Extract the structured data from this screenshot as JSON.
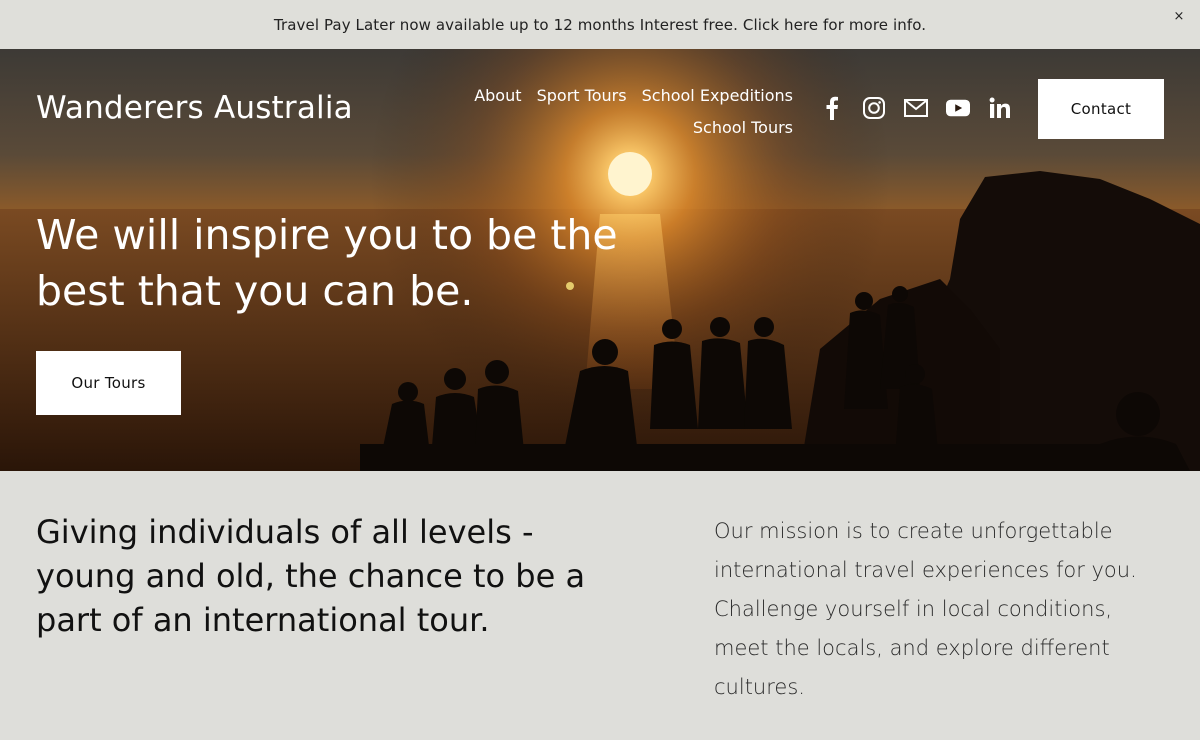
{
  "announcement": {
    "text": "Travel Pay Later now available up to 12 months Interest free. Click here for more info.",
    "close_symbol": "×"
  },
  "header": {
    "site_title": "Wanderers Australia",
    "nav": [
      {
        "label": "About"
      },
      {
        "label": "Sport Tours"
      },
      {
        "label": "School Expeditions"
      },
      {
        "label": "School Tours"
      }
    ],
    "social_icons": [
      "facebook-icon",
      "instagram-icon",
      "email-icon",
      "youtube-icon",
      "linkedin-icon"
    ],
    "contact_label": "Contact"
  },
  "hero": {
    "headline": "We will inspire you to be the best that you can be.",
    "cta_label": "Our Tours"
  },
  "intro": {
    "heading": "Giving individuals of all levels - young and old, the chance to be a part of an international tour.",
    "body": "Our mission is to create unforgettable international travel experiences for you. Challenge yourself in local conditions, meet the locals, and explore different cultures."
  },
  "colors": {
    "page_background": "#dededa",
    "button_background": "#ffffff",
    "hero_text": "#ffffff"
  }
}
